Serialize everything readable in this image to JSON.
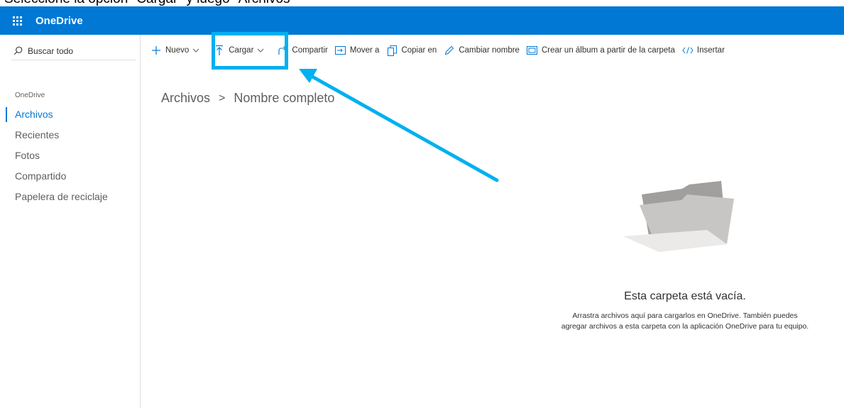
{
  "caption": "Seleccione la opción \"Cargar\" y luego \"Archivos\"",
  "topbar": {
    "app_name": "OneDrive",
    "background_color": "#0078d4"
  },
  "sidebar": {
    "search_placeholder": "Buscar todo",
    "heading": "OneDrive",
    "items": [
      {
        "label": "Archivos",
        "active": true
      },
      {
        "label": "Recientes",
        "active": false
      },
      {
        "label": "Fotos",
        "active": false
      },
      {
        "label": "Compartido",
        "active": false
      },
      {
        "label": "Papelera de reciclaje",
        "active": false
      }
    ]
  },
  "commandbar": {
    "new_label": "Nuevo",
    "upload_label": "Cargar",
    "share_label": "Compartir",
    "move_label": "Mover a",
    "copy_label": "Copiar en",
    "rename_label": "Cambiar nombre",
    "album_label": "Crear un álbum a partir de la carpeta",
    "embed_label": "Insertar"
  },
  "breadcrumb": {
    "root": "Archivos",
    "current": "Nombre completo",
    "separator": ">"
  },
  "empty_state": {
    "title": "Esta carpeta está vacía.",
    "description": "Arrastra archivos aquí para cargarlos en OneDrive. También puedes agregar archivos a esta carpeta con la aplicación OneDrive para tu equipo."
  },
  "annotation": {
    "highlight_color": "#00b0f0",
    "target": "upload-button"
  }
}
